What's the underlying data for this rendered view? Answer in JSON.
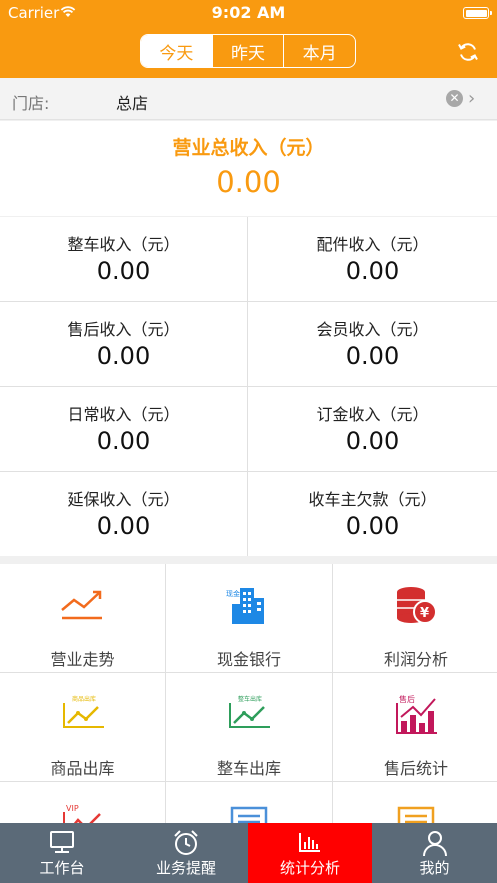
{
  "status_bar": {
    "carrier": "Carrier",
    "time": "9:02 AM"
  },
  "period_tabs": [
    {
      "label": "今天",
      "active": true
    },
    {
      "label": "昨天",
      "active": false
    },
    {
      "label": "本月",
      "active": false
    }
  ],
  "store": {
    "label": "门店:",
    "value": "总店",
    "clear_glyph": "✕",
    "chevron_glyph": "›"
  },
  "total": {
    "label": "营业总收入（元）",
    "value": "0.00"
  },
  "income_cells": [
    {
      "label": "整车收入（元）",
      "value": "0.00"
    },
    {
      "label": "配件收入（元）",
      "value": "0.00"
    },
    {
      "label": "售后收入（元）",
      "value": "0.00"
    },
    {
      "label": "会员收入（元）",
      "value": "0.00"
    },
    {
      "label": "日常收入（元）",
      "value": "0.00"
    },
    {
      "label": "订金收入（元）",
      "value": "0.00"
    },
    {
      "label": "延保收入（元）",
      "value": "0.00"
    },
    {
      "label": "收车主欠款（元）",
      "value": "0.00"
    }
  ],
  "menu_items": [
    {
      "label": "营业走势",
      "icon": "trend-icon"
    },
    {
      "label": "现金银行",
      "icon": "bank-icon",
      "icon_text": "现金"
    },
    {
      "label": "利润分析",
      "icon": "profit-icon",
      "icon_text": "¥"
    },
    {
      "label": "商品出库",
      "icon": "goods-out-icon",
      "icon_text": "商品出库"
    },
    {
      "label": "整车出库",
      "icon": "vehicle-out-icon",
      "icon_text": "整车出库"
    },
    {
      "label": "售后统计",
      "icon": "after-sales-icon",
      "icon_text": "售后"
    },
    {
      "label": "",
      "icon": "vip-chart-icon",
      "icon_text": "VIP"
    },
    {
      "label": "",
      "icon": "report-blue-icon"
    },
    {
      "label": "",
      "icon": "report-orange-icon"
    }
  ],
  "tab_bar": [
    {
      "label": "工作台",
      "icon": "desktop-icon",
      "active": false
    },
    {
      "label": "业务提醒",
      "icon": "alarm-clock-icon",
      "active": false
    },
    {
      "label": "统计分析",
      "icon": "bar-chart-icon",
      "active": true
    },
    {
      "label": "我的",
      "icon": "person-icon",
      "active": false
    }
  ],
  "colors": {
    "accent": "#f99a10",
    "tab_active": "#ff0000",
    "tab_bar": "#5b6a78"
  }
}
